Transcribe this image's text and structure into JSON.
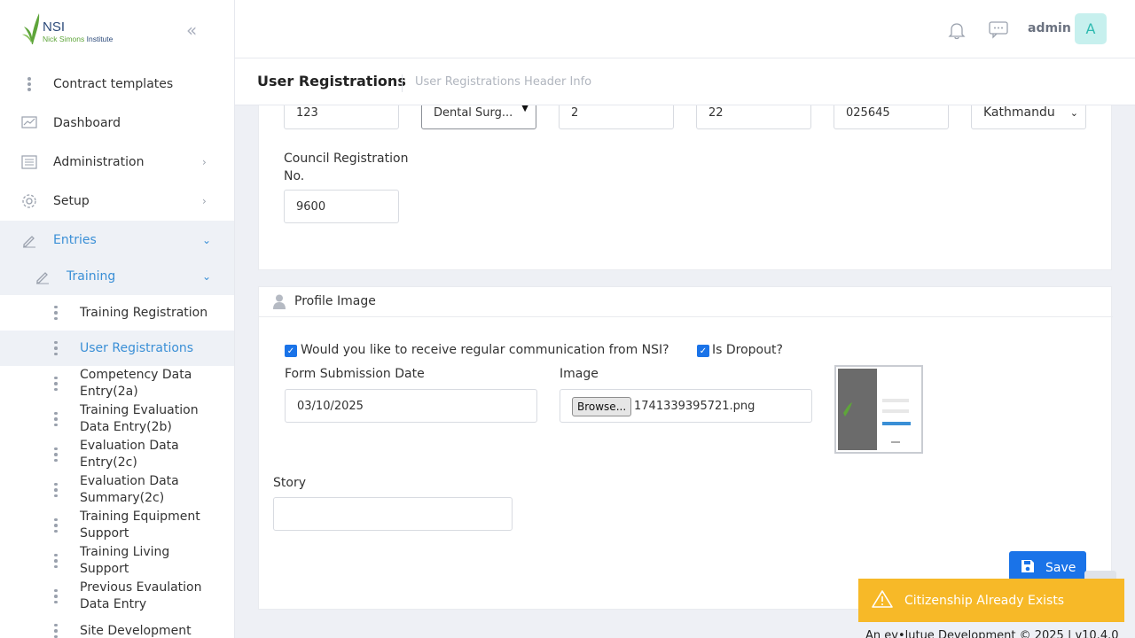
{
  "sidebar": {
    "logo": {
      "nsi": "NSI",
      "org_part1": "Nick Simons",
      "org_part2": "Institute"
    },
    "items": [
      {
        "label": "Contract templates"
      },
      {
        "label": "Dashboard"
      },
      {
        "label": "Administration"
      },
      {
        "label": "Setup"
      },
      {
        "label": "Entries"
      },
      {
        "label": "Training"
      }
    ],
    "sub_items": [
      {
        "label": "Training Registration"
      },
      {
        "label": "User Registrations"
      },
      {
        "label": "Competency Data Entry(2a)"
      },
      {
        "label": "Training Evaluation Data Entry(2b)"
      },
      {
        "label": "Evaluation Data Entry(2c)"
      },
      {
        "label": "Evaluation Data Summary(2c)"
      },
      {
        "label": "Training Equipment Support"
      },
      {
        "label": "Training Living Support"
      },
      {
        "label": "Previous Evaulation Data Entry"
      },
      {
        "label": "Site Development"
      }
    ]
  },
  "header": {
    "user_name": "admin",
    "avatar_initial": "A",
    "page_title": "User Registrations",
    "page_subtitle": "User Registrations Header Info"
  },
  "form": {
    "row_values": [
      "123",
      "Dental Surg...",
      "2",
      "22",
      "025645",
      "Kathmandu"
    ],
    "council_label": "Council Registration No.",
    "council_value": "9600",
    "profile_section_title": "Profile Image",
    "communication_label": "Would you like to receive regular communication from NSI?",
    "communication_checked": true,
    "dropout_label": "Is Dropout?",
    "dropout_checked": true,
    "submission_date_label": "Form Submission Date",
    "submission_date_value": "03/10/2025",
    "image_label": "Image",
    "browse_label": "Browse...",
    "image_filename": "1741339395721.png",
    "story_label": "Story",
    "story_value": ""
  },
  "actions": {
    "save_label": "Save"
  },
  "toast": {
    "message": "Citizenship Already Exists",
    "color": "#f7b928"
  },
  "footer": {
    "text": "An ev•lutue Development © 2025 | v10.4.0"
  },
  "colors": {
    "accent": "#1a73e8",
    "active_text": "#3a8fd6",
    "avatar_bg": "#c7f0ee"
  }
}
